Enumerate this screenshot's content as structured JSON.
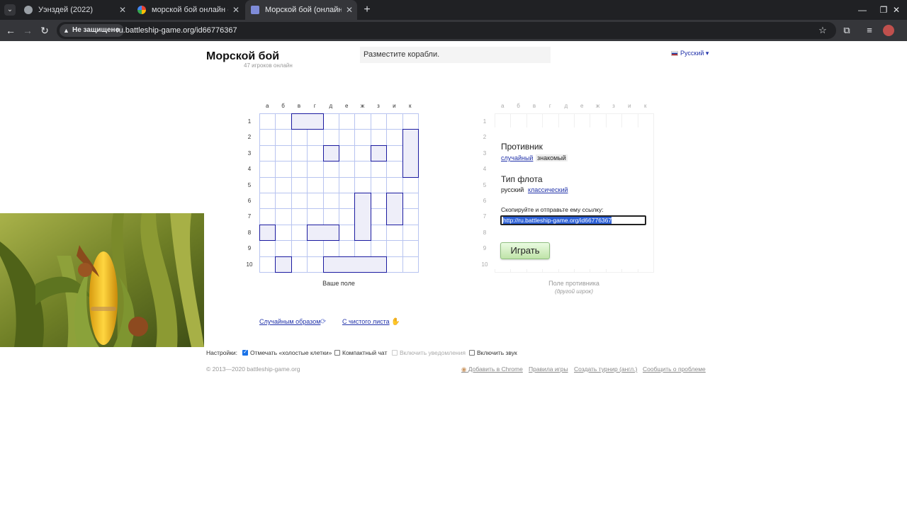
{
  "browser": {
    "tabs": [
      {
        "title": "Уэнздей (2022)",
        "active": false
      },
      {
        "title": "морской бой онлайн - Поиск",
        "active": false
      },
      {
        "title": "Морской бой (онлайн-игра д",
        "active": true
      }
    ],
    "security_label": "Не защищено",
    "url": "ru.battleship-game.org/id66776367"
  },
  "header": {
    "logo": "Морской бой",
    "online_count": "47 игроков онлайн",
    "notice": "Разместите корабли.",
    "language": "Русский"
  },
  "board": {
    "columns": [
      "а",
      "б",
      "в",
      "г",
      "д",
      "е",
      "ж",
      "з",
      "и",
      "к"
    ],
    "rows": [
      "1",
      "2",
      "3",
      "4",
      "5",
      "6",
      "7",
      "8",
      "9",
      "10"
    ]
  },
  "your_board": {
    "caption": "Ваше поле",
    "ships": [
      {
        "col": 2,
        "row": 0,
        "w": 2,
        "h": 1
      },
      {
        "col": 9,
        "row": 1,
        "w": 1,
        "h": 3
      },
      {
        "col": 4,
        "row": 2,
        "w": 1,
        "h": 1
      },
      {
        "col": 7,
        "row": 2,
        "w": 1,
        "h": 1
      },
      {
        "col": 6,
        "row": 5,
        "w": 1,
        "h": 3
      },
      {
        "col": 8,
        "row": 5,
        "w": 1,
        "h": 2
      },
      {
        "col": 0,
        "row": 7,
        "w": 1,
        "h": 1
      },
      {
        "col": 3,
        "row": 7,
        "w": 2,
        "h": 1
      },
      {
        "col": 1,
        "row": 9,
        "w": 1,
        "h": 1
      },
      {
        "col": 4,
        "row": 9,
        "w": 4,
        "h": 1
      }
    ]
  },
  "enemy_board": {
    "caption": "Поле противника",
    "subcaption": "(другой игрок)"
  },
  "setup": {
    "opponent_title": "Противник",
    "opponent_random": "случайный",
    "opponent_known": "знакомый",
    "fleet_title": "Тип флота",
    "fleet_russian": "русский",
    "fleet_classic": "классический",
    "copy_label": "Скопируйте и отправьте ему ссылку:",
    "link_value": "http://ru.battleship-game.org/id66776367",
    "play_label": "Играть"
  },
  "actions": {
    "random": "Случайным образом",
    "clear": "С чистого листа"
  },
  "settings": {
    "label": "Настройки:",
    "options": [
      {
        "label": "Отмечать «холостые клетки»",
        "checked": true,
        "disabled": false
      },
      {
        "label": "Компактный чат",
        "checked": false,
        "disabled": false
      },
      {
        "label": "Включить уведомления",
        "checked": false,
        "disabled": true
      },
      {
        "label": "Включить звук",
        "checked": false,
        "disabled": false
      }
    ]
  },
  "footer": {
    "copyright": "© 2013—2020 battleship-game.org",
    "links": [
      "Добавить в Chrome",
      "Правила игры",
      "Создать турнир (англ.)",
      "Сообщить о проблеме"
    ]
  }
}
